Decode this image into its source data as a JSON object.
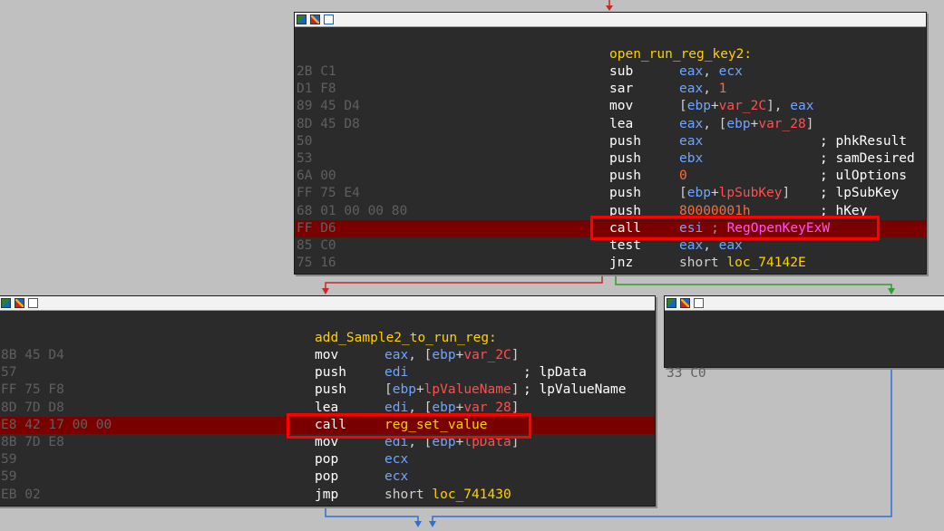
{
  "colors": {
    "background": "#c0c0c0",
    "node_bg": "#2b2b2b",
    "highlight_row": "#7a0000",
    "label": "#ffd000",
    "register": "#6fa5ff",
    "variable": "#ff4f4f",
    "immediate": "#ff6a3d",
    "api_name": "#ff4fff",
    "bytes": "#5f5f5f",
    "edge_true": "#2e9e2e",
    "edge_false": "#c62828",
    "edge_plain": "#2d6fd6",
    "callout": "#ff0000"
  },
  "titlebar_icons": [
    "graph-overview-icon",
    "edit-icon",
    "window-icon"
  ],
  "top_node": {
    "label": "open_run_reg_key2:",
    "rows": [
      {
        "bytes": "2B C1",
        "mn": "sub",
        "ops": "eax, ecx"
      },
      {
        "bytes": "D1 F8",
        "mn": "sar",
        "ops": "eax, 1"
      },
      {
        "bytes": "89 45 D4",
        "mn": "mov",
        "ops": "[ebp+var_2C], eax"
      },
      {
        "bytes": "8D 45 D8",
        "mn": "lea",
        "ops": "eax, [ebp+var_28]"
      },
      {
        "bytes": "50",
        "mn": "push",
        "ops": "eax",
        "comment": "; phkResult"
      },
      {
        "bytes": "53",
        "mn": "push",
        "ops": "ebx",
        "comment": "; samDesired"
      },
      {
        "bytes": "6A 00",
        "mn": "push",
        "ops": "0",
        "comment": "; ulOptions"
      },
      {
        "bytes": "FF 75 E4",
        "mn": "push",
        "ops": "[ebp+lpSubKey]",
        "comment": "; lpSubKey"
      },
      {
        "bytes": "68 01 00 00 80",
        "mn": "push",
        "ops": "80000001h",
        "comment": "; hKey"
      },
      {
        "bytes": "FF D6",
        "mn": "call",
        "ops": "esi",
        "comment": "; RegOpenKeyExW"
      },
      {
        "bytes": "85 C0",
        "mn": "test",
        "ops": "eax, eax"
      },
      {
        "bytes": "75 16",
        "mn": "jnz",
        "ops": "short loc_74142E"
      }
    ]
  },
  "left_node": {
    "label": "add_Sample2_to_run_reg:",
    "rows": [
      {
        "bytes": "8B 45 D4",
        "mn": "mov",
        "ops": "eax, [ebp+var_2C]"
      },
      {
        "bytes": "57",
        "mn": "push",
        "ops": "edi",
        "comment": "; lpData"
      },
      {
        "bytes": "FF 75 F8",
        "mn": "push",
        "ops": "[ebp+lpValueName]",
        "comment": "; lpValueName"
      },
      {
        "bytes": "8D 7D D8",
        "mn": "lea",
        "ops": "edi, [ebp+var_28]"
      },
      {
        "bytes": "E8 42 17 00 00",
        "mn": "call",
        "ops": "reg_set_value"
      },
      {
        "bytes": "8B 7D E8",
        "mn": "mov",
        "ops": "edi, [ebp+lpData]"
      },
      {
        "bytes": "59",
        "mn": "pop",
        "ops": "ecx"
      },
      {
        "bytes": "59",
        "mn": "pop",
        "ops": "ecx"
      },
      {
        "bytes": "EB 02",
        "mn": "jmp",
        "ops": "short loc_741430"
      }
    ]
  },
  "right_node": {
    "rows": [
      {
        "bytes": "33 C0"
      }
    ]
  }
}
